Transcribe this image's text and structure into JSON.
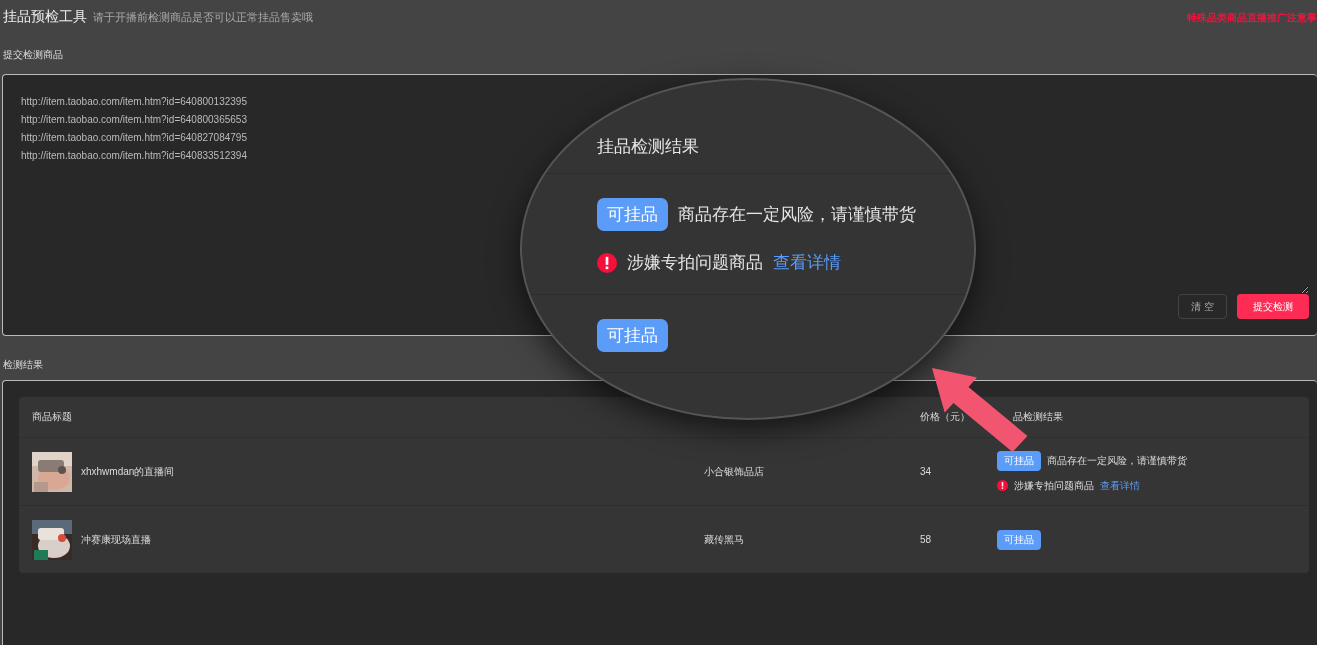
{
  "header": {
    "title": "挂品预检工具",
    "subtitle": "请于开播前检测商品是否可以正常挂品售卖哦",
    "notice_link": "特殊品类商品直播推广注意事"
  },
  "submit_section": {
    "label": "提交检测商品",
    "links": [
      "http://item.taobao.com/item.htm?id=640800132395",
      "http://item.taobao.com/item.htm?id=640800365653",
      "http://item.taobao.com/item.htm?id=640827084795",
      "http://item.taobao.com/item.htm?id=640833512394"
    ],
    "buttons": [
      {
        "label": "清 空",
        "kind": "secondary"
      },
      {
        "label": "提交检测",
        "kind": "primary"
      }
    ]
  },
  "results_section": {
    "label": "检测结果",
    "columns": {
      "title": "商品标题",
      "price": "价格（元）",
      "result": "品检测结果"
    },
    "rows": [
      {
        "title": "xhxhwmdan的直播间",
        "store": "小合银饰品店",
        "price": "34",
        "status": "可挂品",
        "note": "商品存在一定风险，请谨慎带货",
        "warning": "涉嫌专拍问题商品",
        "warning_link": "查看详情"
      },
      {
        "title": "冲赛康现场直播",
        "store": "藏传黑马",
        "price": "58",
        "status": "可挂品"
      }
    ]
  },
  "magnifier": {
    "title": "挂品检测结果",
    "items": [
      {
        "status": "可挂品",
        "note": "商品存在一定风险，请谨慎带货",
        "warning": "涉嫌专拍问题商品",
        "warning_link": "查看详情"
      },
      {
        "status": "可挂品"
      }
    ]
  }
}
